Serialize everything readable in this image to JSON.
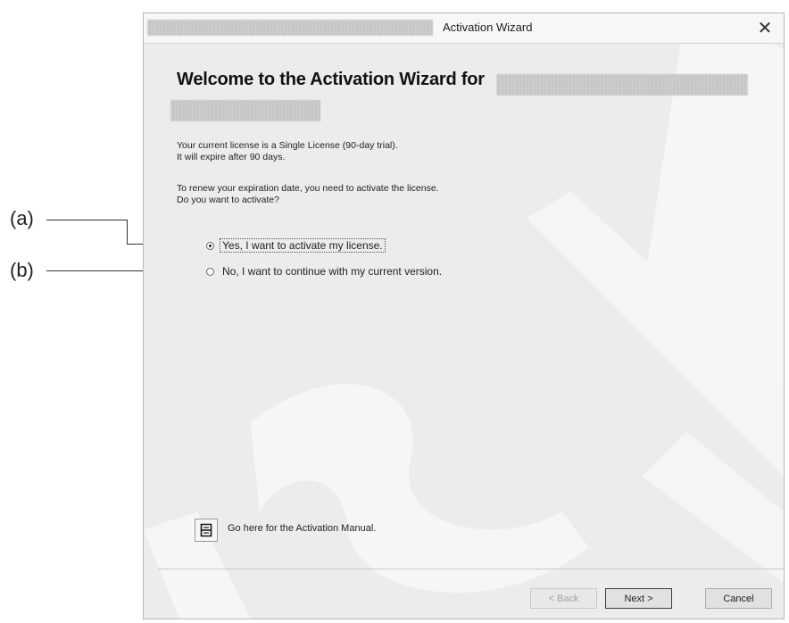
{
  "callouts": {
    "a": "(a)",
    "b": "(b)"
  },
  "window": {
    "title": "Activation Wizard",
    "close_glyph": "✕"
  },
  "content": {
    "heading": "Welcome to the Activation Wizard for",
    "license_line1": "Your current license is a Single License (90-day trial).",
    "license_line2": "It will expire after 90 days.",
    "renew_line1": "To renew your expiration date, you need to activate the license.",
    "renew_line2": "Do you want to activate?"
  },
  "options": {
    "yes_label": "Yes, I want to activate my license.",
    "no_label": "No, I want to continue with my current version.",
    "selected": "yes"
  },
  "manual": {
    "label": "Go here for the Activation Manual.",
    "icon": "document-icon"
  },
  "buttons": {
    "back": "< Back",
    "next": "Next >",
    "cancel": "Cancel"
  },
  "colors": {
    "window_bg": "#ececec",
    "watermark": "#ffffff"
  }
}
